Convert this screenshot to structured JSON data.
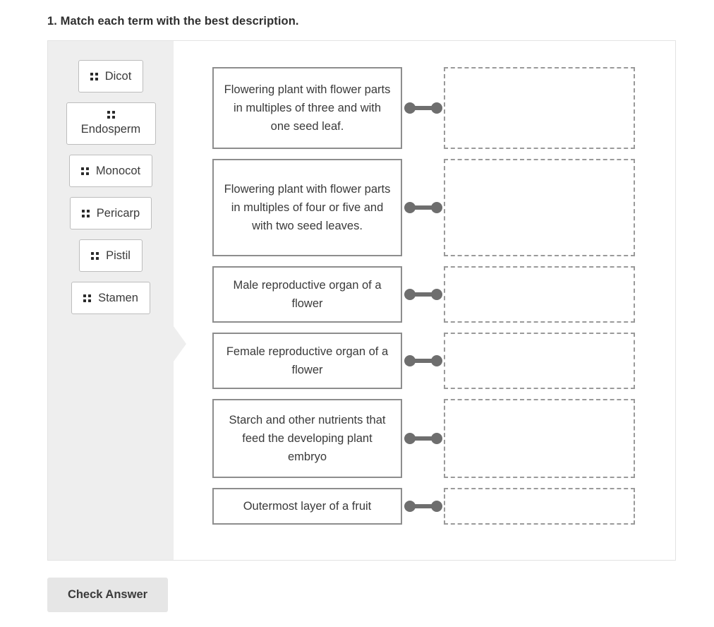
{
  "prompt": "1. Match each term with the best description.",
  "term_bank": {
    "handle_icon": "drag-handle-icon",
    "terms": [
      {
        "label": "Dicot",
        "wraps": false
      },
      {
        "label": "Endosperm",
        "wraps": true
      },
      {
        "label": "Monocot",
        "wraps": false
      },
      {
        "label": "Pericarp",
        "wraps": false
      },
      {
        "label": "Pistil",
        "wraps": false
      },
      {
        "label": "Stamen",
        "wraps": false
      }
    ]
  },
  "rows": [
    {
      "description": "Flowering plant with flower parts in multiples of three and with one seed leaf.",
      "answer": ""
    },
    {
      "description": "Flowering plant with flower parts in multiples of four or five and with two seed leaves.",
      "answer": ""
    },
    {
      "description": "Male reproductive organ of a flower",
      "answer": ""
    },
    {
      "description": "Female reproductive organ of a flower",
      "answer": ""
    },
    {
      "description": "Starch and other nutrients that feed the developing plant embryo",
      "answer": ""
    },
    {
      "description": "Outermost layer of a fruit",
      "answer": ""
    }
  ],
  "footer": {
    "check_label": "Check Answer"
  },
  "colors": {
    "bank_background": "#eeeeee",
    "panel_border": "#e3e3e3",
    "card_border": "#8d8d8d",
    "dropzone_border": "#9a9a9a",
    "connector": "#6e6e6e",
    "button_background": "#e6e6e6",
    "text": "#3a3a3a"
  }
}
